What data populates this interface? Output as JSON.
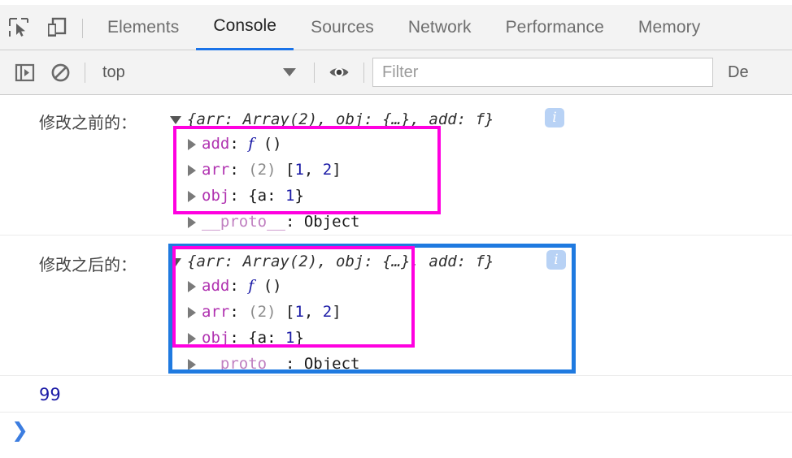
{
  "tabbar": {
    "icons": [
      {
        "name": "inspect-element-icon",
        "label": "Inspect element"
      },
      {
        "name": "device-toolbar-icon",
        "label": "Toggle device toolbar"
      }
    ],
    "tabs": [
      {
        "label": "Elements",
        "active": false
      },
      {
        "label": "Console",
        "active": true
      },
      {
        "label": "Sources",
        "active": false
      },
      {
        "label": "Network",
        "active": false
      },
      {
        "label": "Performance",
        "active": false
      },
      {
        "label": "Memory",
        "active": false
      }
    ]
  },
  "console_toolbar": {
    "sidebar_toggle_icon": "console-sidebar-icon",
    "clear_icon": "clear-console-icon",
    "context_label": "top",
    "caret_icon": "chevron-down-icon",
    "eye_icon": "eye-icon",
    "filter_placeholder": "Filter",
    "filter_value": "",
    "levels_label": "De"
  },
  "console": {
    "messages": [
      {
        "cn_label": "修改之前的：",
        "root_toggle": "triangle-down-icon",
        "preview": "{arr: Array(2), obj: {…}, add: f}",
        "info_badge": "i",
        "props": [
          {
            "toggle": "triangle-right-icon",
            "name": "add",
            "sep": ": ",
            "value_fn": "f",
            "value_rest": " ()"
          },
          {
            "toggle": "triangle-right-icon",
            "name": "arr",
            "sep": ": ",
            "value_gray": "(2)",
            "value_bracket_open": " [",
            "v1": "1",
            "comma": ", ",
            "v2": "2",
            "value_bracket_close": "]"
          },
          {
            "toggle": "triangle-right-icon",
            "name": "obj",
            "sep": ": ",
            "value_open": "{a: ",
            "v1": "1",
            "value_close": "}"
          },
          {
            "toggle": "triangle-right-icon",
            "name": "__proto__",
            "sep": ": ",
            "value_plain": "Object"
          }
        ]
      },
      {
        "cn_label": "修改之后的：",
        "root_toggle": "triangle-down-icon",
        "preview": "{arr: Array(2), obj: {…}, add: f}",
        "info_badge": "i",
        "props": [
          {
            "toggle": "triangle-right-icon",
            "name": "add",
            "sep": ": ",
            "value_fn": "f",
            "value_rest": " ()"
          },
          {
            "toggle": "triangle-right-icon",
            "name": "arr",
            "sep": ": ",
            "value_gray": "(2)",
            "value_bracket_open": " [",
            "v1": "1",
            "comma": ", ",
            "v2": "2",
            "value_bracket_close": "]"
          },
          {
            "toggle": "triangle-right-icon",
            "name": "obj",
            "sep": ": ",
            "value_open": "{a: ",
            "v1": "1",
            "value_close": "}"
          },
          {
            "toggle": "triangle-right-icon",
            "name": "__proto__",
            "sep": ": ",
            "value_plain": "Object"
          }
        ]
      }
    ],
    "result_value": "99",
    "prompt_glyph": "❯"
  },
  "colors": {
    "highlight_magenta": "#ff00e0",
    "highlight_blue": "#1f7ae0",
    "accent_tab": "#1a73e8",
    "number_blue": "#1a1aa6",
    "property_magenta": "#b032b0",
    "info_badge_bg": "#b8d2f5"
  }
}
